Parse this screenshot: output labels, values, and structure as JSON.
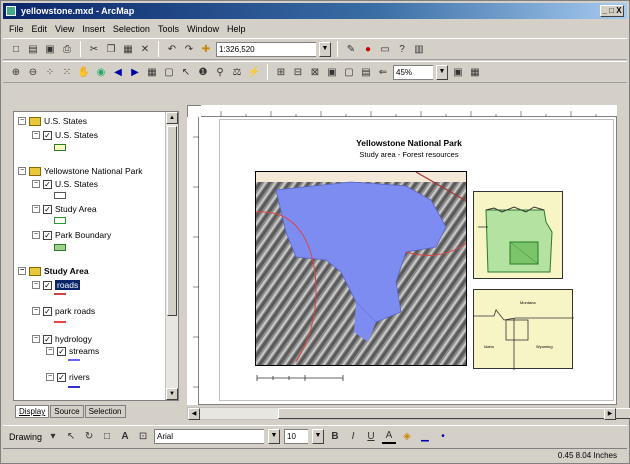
{
  "window": {
    "title": "yellowstone.mxd - ArcMap",
    "controls": "_ □ X"
  },
  "menu": [
    "File",
    "Edit",
    "View",
    "Insert",
    "Selection",
    "Tools",
    "Window",
    "Help"
  ],
  "toolbar1": {
    "scale": "1:326,520"
  },
  "toolbar2": {
    "zoom": "45%"
  },
  "toc": {
    "groups": [
      {
        "name": "U.S. States",
        "layers": [
          "U.S. States"
        ]
      },
      {
        "name": "Yellowstone National Park",
        "layers": [
          "U.S. States",
          "Study Area",
          "Park Boundary"
        ]
      },
      {
        "name": "Study Area",
        "layers": [
          "roads",
          "park roads",
          "hydrology",
          "streams",
          "rivers"
        ]
      }
    ],
    "selected_layer": "roads",
    "tabs": [
      "Display",
      "Source",
      "Selection"
    ]
  },
  "layout": {
    "title": "Yellowstone National Park",
    "subtitle": "Study area - Forest resources",
    "inset_labels": [
      "Montana",
      "Idaho",
      "Wyoming"
    ]
  },
  "drawing": {
    "label": "Drawing",
    "font": "Arial",
    "font_size": "10",
    "bold": "B",
    "italic": "I",
    "underline": "U",
    "text_color": "A"
  },
  "status": {
    "coords": "0.45 8.04 Inches"
  },
  "colors": {
    "water": "#7d8cf0",
    "terrain": "#8a8a8a",
    "inset_bg": "#f7f4c6",
    "park": "#9bd48a"
  }
}
